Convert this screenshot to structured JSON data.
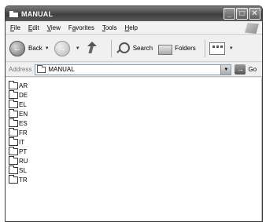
{
  "window": {
    "title": "MANUAL"
  },
  "menu": [
    "File",
    "Edit",
    "View",
    "Favorites",
    "Tools",
    "Help"
  ],
  "menu_underline": [
    "F",
    "E",
    "V",
    "a",
    "T",
    "H"
  ],
  "toolbar": {
    "back_label": "Back",
    "search_label": "Search",
    "folders_label": "Folders"
  },
  "address": {
    "label": "Address",
    "value": "MANUAL",
    "go_label": "Go"
  },
  "folders": [
    "AR",
    "DE",
    "EL",
    "EN",
    "ES",
    "FR",
    "IT",
    "PT",
    "RU",
    "SL",
    "TR"
  ]
}
